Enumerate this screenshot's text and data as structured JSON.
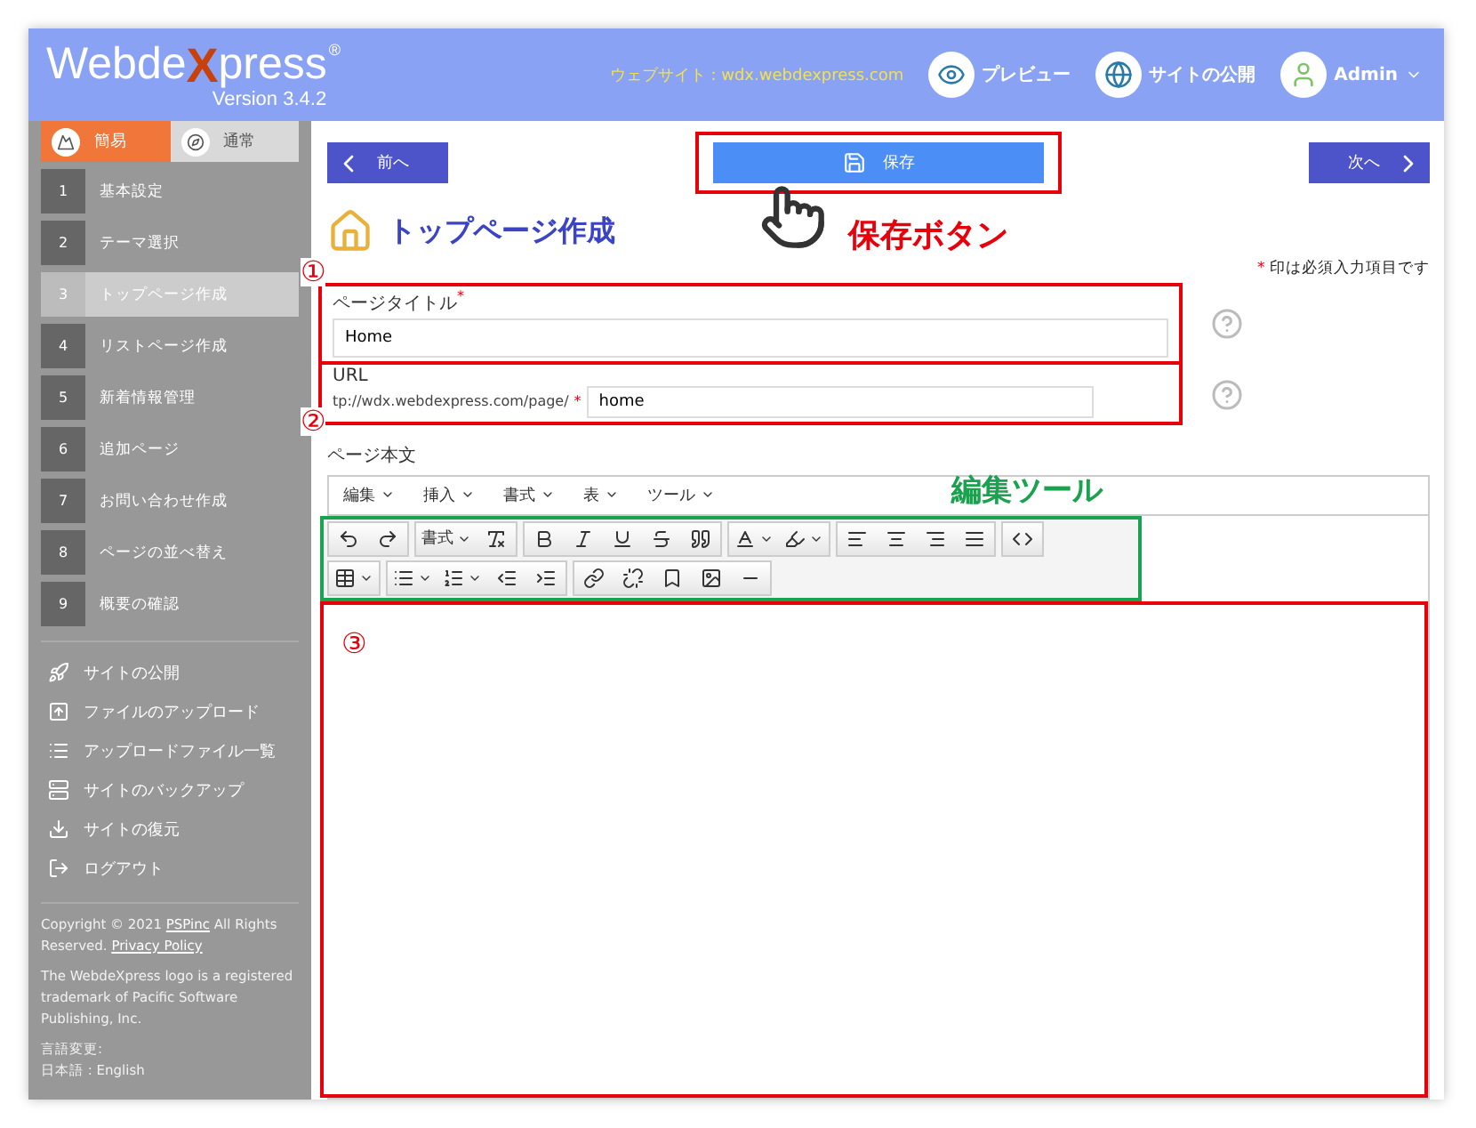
{
  "header": {
    "logo": {
      "left": "Webde",
      "mark": "X",
      "right": "press",
      "registered": "®",
      "version": "Version 3.4.2"
    },
    "website": "ウェブサイト : wdx.webdexpress.com",
    "preview": "プレビュー",
    "publish": "サイトの公開",
    "user": "Admin"
  },
  "sidebar": {
    "modes": [
      {
        "label": "簡易",
        "selected": true
      },
      {
        "label": "通常",
        "selected": false
      }
    ],
    "steps": [
      {
        "number": "1",
        "label": "基本設定",
        "selected": false
      },
      {
        "number": "2",
        "label": "テーマ選択",
        "selected": false
      },
      {
        "number": "3",
        "label": "トップページ作成",
        "selected": true
      },
      {
        "number": "4",
        "label": "リストページ作成",
        "selected": false
      },
      {
        "number": "5",
        "label": "新着情報管理",
        "selected": false
      },
      {
        "number": "6",
        "label": "追加ページ",
        "selected": false
      },
      {
        "number": "7",
        "label": "お問い合わせ作成",
        "selected": false
      },
      {
        "number": "8",
        "label": "ページの並べ替え",
        "selected": false
      },
      {
        "number": "9",
        "label": "概要の確認",
        "selected": false
      }
    ],
    "tools": [
      "サイトの公開",
      "ファイルのアップロード",
      "アップロードファイル一覧",
      "サイトのバックアップ",
      "サイトの復元",
      "ログアウト"
    ],
    "footer": {
      "copyright": "Copyright © 2021 ",
      "company": "PSPinc",
      "rights": " All Rights Reserved. ",
      "privacy": "Privacy Policy",
      "trademark": "The WebdeXpress logo is a registered trademark of Pacific Software Publishing, Inc.",
      "language_label": "言語変更:",
      "languages": "日本語 : English"
    }
  },
  "content": {
    "prev": "前へ",
    "save": "保存",
    "next": "次へ",
    "page_title": "トップページ作成",
    "required_mark": "*",
    "required_note": " 印は必須入力項目です",
    "title_field": {
      "label": "ページタイトル",
      "required": true,
      "value": "Home"
    },
    "url_field": {
      "label": "URL",
      "prefix": "tp://wdx.webdexpress.com/page/",
      "required": true,
      "value": "home"
    },
    "body_label": "ページ本文",
    "menu": [
      "編集",
      "挿入",
      "書式",
      "表",
      "ツール"
    ],
    "format_button": "書式"
  },
  "annotations": {
    "save_callout": "保存ボタン",
    "tools_callout": "編集ツール",
    "markers": [
      "①",
      "②",
      "③"
    ]
  }
}
